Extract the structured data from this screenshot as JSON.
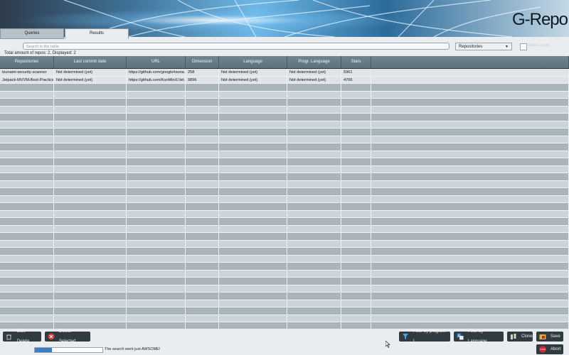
{
  "app": {
    "brand": "G-Repo"
  },
  "tabs": [
    {
      "label": "Queries",
      "active": false
    },
    {
      "label": "Results",
      "active": true
    }
  ],
  "search": {
    "placeholder": "Search in the table"
  },
  "filter_select": {
    "value": "Repositories"
  },
  "checkbox": {
    "label": "Select mode",
    "checked": false
  },
  "summary": "Total amount of repos: 2, Displayed: 2",
  "table": {
    "columns": [
      "Repositories",
      "Last commit date",
      "URL",
      "Dimension (KByte)",
      "Language",
      "Progr. Language",
      "Stars"
    ],
    "rows": [
      [
        "tsunami-security-scanner",
        "Not determined (yet)",
        "https://github.com/google/tsuna...",
        "258",
        "Not determined (yet)",
        "Not determined (yet)",
        "5961"
      ],
      [
        "Jetpack-MVVM-Best-Practice",
        "Not determined (yet)",
        "https://github.com/KunMinX/Jet...",
        "9896",
        "Not determined (yet)",
        "Not determined (yet)",
        "4766"
      ]
    ]
  },
  "toolbar": {
    "bulk_delete": "Bulk Delete",
    "delete_selected": "Delete Selected",
    "filter_program": "Filter by program. L",
    "filter_language": "Filter by Language",
    "clone": "Clone",
    "save": "Save",
    "abort": "Abort"
  },
  "icons": {
    "bulk_delete": "trash-icon",
    "delete_selected": "red-x-icon",
    "filter_program": "funnel-icon",
    "filter_language": "translate-icon",
    "clone": "clone-icon",
    "save": "folder-save-icon",
    "abort": "stop-icon"
  },
  "status": {
    "message": "The search went just AWSOME!",
    "progress": 0.25
  },
  "colors": {
    "header": "#5d717c",
    "toolbar_button": "#2f3a41",
    "progress": "#3b7ec8"
  }
}
